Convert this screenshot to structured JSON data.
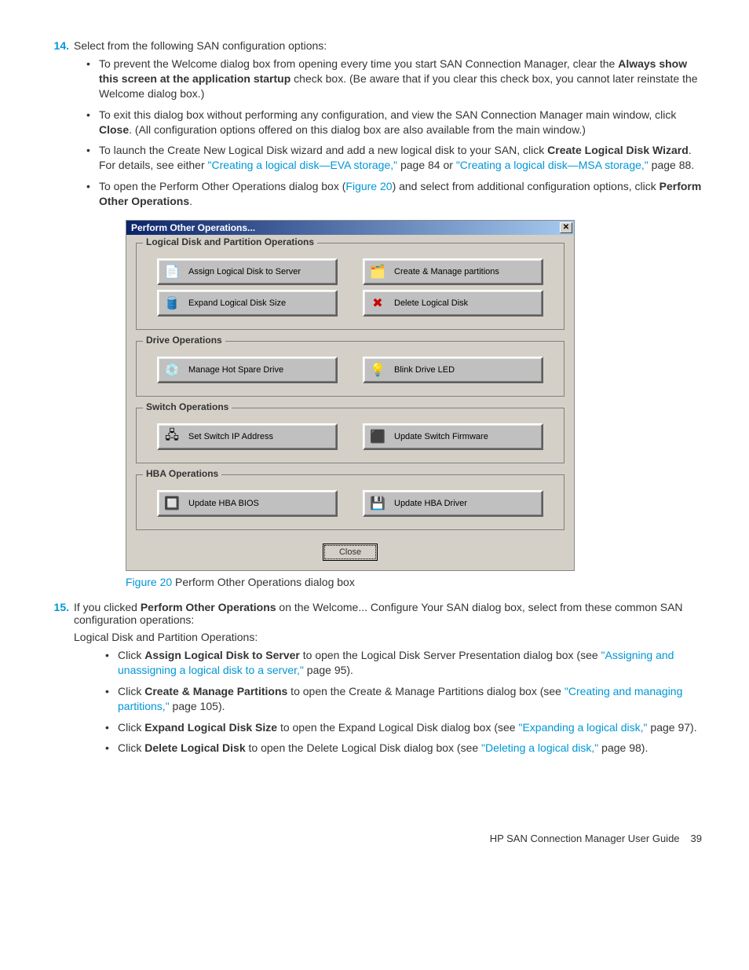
{
  "step14": {
    "num": "14.",
    "intro": "Select from the following SAN configuration options:",
    "b1_pre": "To prevent the Welcome dialog box from opening every time you start SAN Connection Manager, clear the ",
    "b1_bold": "Always show this screen at the application startup",
    "b1_post": " check box. (Be aware that if you clear this check box, you cannot later reinstate the Welcome dialog box.)",
    "b2_pre": "To exit this dialog box without performing any configuration, and view the SAN Connection Manager main window, click ",
    "b2_bold": "Close",
    "b2_post": ". (All configuration options offered on this dialog box are also available from the main window.)",
    "b3_pre": "To launch the Create New Logical Disk wizard and add a new logical disk to your SAN, click ",
    "b3_bold": "Create Logical Disk Wizard",
    "b3_mid": ". For details, see either ",
    "b3_link1": "\"Creating a logical disk—EVA storage,\"",
    "b3_p1": " page 84 or ",
    "b3_link2": "\"Creating a logical disk—MSA storage,\"",
    "b3_p2": " page 88.",
    "b4_pre": "To open the Perform Other Operations dialog box (",
    "b4_link": "Figure 20",
    "b4_mid": ") and select from additional configuration options, click ",
    "b4_bold": "Perform Other Operations",
    "b4_post": "."
  },
  "dialog": {
    "title": "Perform Other Operations...",
    "close_x": "✕",
    "g1": "Logical Disk and Partition Operations",
    "g2": "Drive Operations",
    "g3": "Switch Operations",
    "g4": "HBA Operations",
    "btn_assign": "Assign Logical Disk to Server",
    "btn_partitions": "Create & Manage partitions",
    "btn_expand": "Expand Logical Disk Size",
    "btn_delete": "Delete Logical Disk",
    "btn_hotspare": "Manage Hot Spare Drive",
    "btn_blink": "Blink Drive LED",
    "btn_switchip": "Set Switch IP Address",
    "btn_switchfw": "Update Switch Firmware",
    "btn_hbabios": "Update HBA BIOS",
    "btn_hbadrv": "Update HBA Driver",
    "close": "Close"
  },
  "caption": {
    "label": "Figure 20",
    "text": " Perform Other Operations dialog box"
  },
  "step15": {
    "num": "15.",
    "intro_pre": "If you clicked ",
    "intro_bold": "Perform Other Operations",
    "intro_post": " on the Welcome... Configure Your SAN dialog box, select from these common SAN configuration operations:",
    "sub": "Logical Disk and Partition Operations:",
    "b1_pre": "Click ",
    "b1_bold": "Assign Logical Disk to Server",
    "b1_mid": " to open the Logical Disk Server Presentation dialog box (see ",
    "b1_link": "\"Assigning and unassigning a logical disk to a server,\"",
    "b1_post": " page 95).",
    "b2_pre": "Click ",
    "b2_bold": "Create & Manage Partitions",
    "b2_mid": " to open the Create & Manage Partitions dialog box (see ",
    "b2_link": "\"Creating and managing partitions,\"",
    "b2_post": " page 105).",
    "b3_pre": "Click ",
    "b3_bold": "Expand Logical Disk Size",
    "b3_mid": " to open the Expand Logical Disk dialog box (see ",
    "b3_link": "\"Expanding a logical disk,\"",
    "b3_post": " page 97).",
    "b4_pre": "Click ",
    "b4_bold": "Delete Logical Disk",
    "b4_mid": " to open the Delete Logical Disk dialog box (see ",
    "b4_link": "\"Deleting a logical disk,\"",
    "b4_post": " page 98)."
  },
  "footer": {
    "title": "HP SAN Connection Manager User Guide",
    "page": "39"
  }
}
